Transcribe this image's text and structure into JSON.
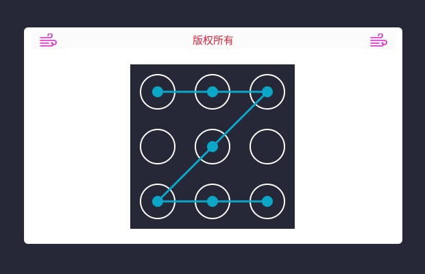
{
  "header": {
    "title": "版权所有",
    "left_icon": "wind-icon",
    "right_icon": "wind-icon",
    "icon_color": "#e31bd2",
    "title_color": "#e0223a"
  },
  "pattern_lock": {
    "grid": 3,
    "ring_color": "#ffffff",
    "line_color": "#0aa7c8",
    "background": "#262838",
    "sequence": [
      1,
      2,
      3,
      5,
      7,
      8,
      9
    ]
  }
}
